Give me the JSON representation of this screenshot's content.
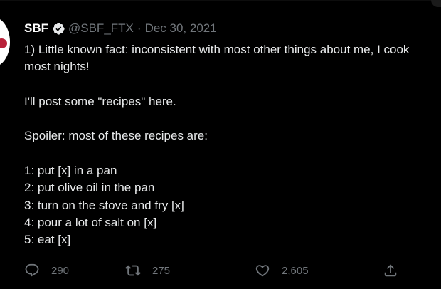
{
  "tweet": {
    "display_name": "SBF",
    "handle": "@SBF_FTX",
    "separator": "·",
    "date": "Dec 30, 2021",
    "lines": [
      "1) Little known fact: inconsistent with most other things about me, I cook",
      "most nights!",
      "",
      "I'll post some \"recipes\" here.",
      "",
      "Spoiler: most of these recipes are:",
      "",
      "1: put [x] in a pan",
      "2: put olive oil in the pan",
      "3: turn on the stove and fry [x]",
      "4: pour a lot of salt on [x]",
      "5: eat [x]"
    ]
  },
  "actions": {
    "replies": "290",
    "retweets": "275",
    "likes": "2,605"
  },
  "icons": {
    "verified": "verified-badge-icon",
    "reply": "reply-bubble-icon",
    "retweet": "retweet-arrows-icon",
    "like": "heart-icon",
    "share": "share-upload-icon"
  },
  "colors": {
    "background": "#000000",
    "text": "#e7e9ea",
    "muted": "#71767b",
    "avatar_accent": "#b9223a"
  }
}
